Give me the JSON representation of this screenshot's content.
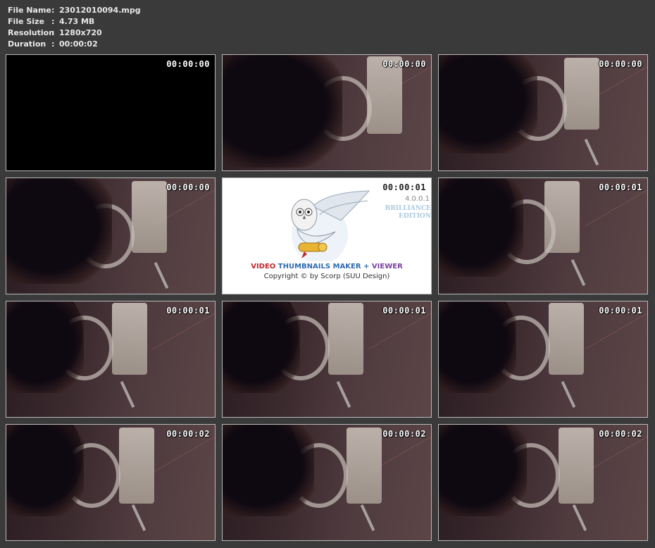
{
  "info": {
    "rows": [
      {
        "label": "File Name",
        "sep": ":",
        "value": "23012010094.mpg"
      },
      {
        "label": "File Size",
        "sep": ":",
        "value": "4.73 MB"
      },
      {
        "label": "Resolution",
        "sep": ":",
        "value": "1280x720"
      },
      {
        "label": "Duration",
        "sep": ":",
        "value": "00:00:02"
      }
    ]
  },
  "thumbnails": [
    {
      "timestamp": "00:00:00",
      "scene": "black"
    },
    {
      "timestamp": "00:00:00",
      "scene": "bathroom"
    },
    {
      "timestamp": "00:00:00",
      "scene": "bathroom"
    },
    {
      "timestamp": "00:00:00",
      "scene": "bathroom"
    },
    {
      "timestamp": "00:00:01",
      "scene": "splash"
    },
    {
      "timestamp": "00:00:01",
      "scene": "bathroom"
    },
    {
      "timestamp": "00:00:01",
      "scene": "bathroom"
    },
    {
      "timestamp": "00:00:01",
      "scene": "bathroom"
    },
    {
      "timestamp": "00:00:01",
      "scene": "bathroom"
    },
    {
      "timestamp": "00:00:02",
      "scene": "bathroom"
    },
    {
      "timestamp": "00:00:02",
      "scene": "bathroom"
    },
    {
      "timestamp": "00:00:02",
      "scene": "bathroom"
    }
  ],
  "splash": {
    "version": "4.0.0.1",
    "edition_line1": "BRILLIANCE",
    "edition_line2": "EDITION",
    "title_word1": "VIDEO",
    "title_word2": "THUMBNAILS",
    "title_word3": "MAKER",
    "title_plus": "+",
    "title_word4": "VIEWER",
    "copyright": "Copyright © by Scorp (SUU Design)"
  },
  "colors": {
    "background": "#3a3a3a",
    "thumb_border": "#b9b9b9",
    "info_text": "#e8e8e8"
  }
}
